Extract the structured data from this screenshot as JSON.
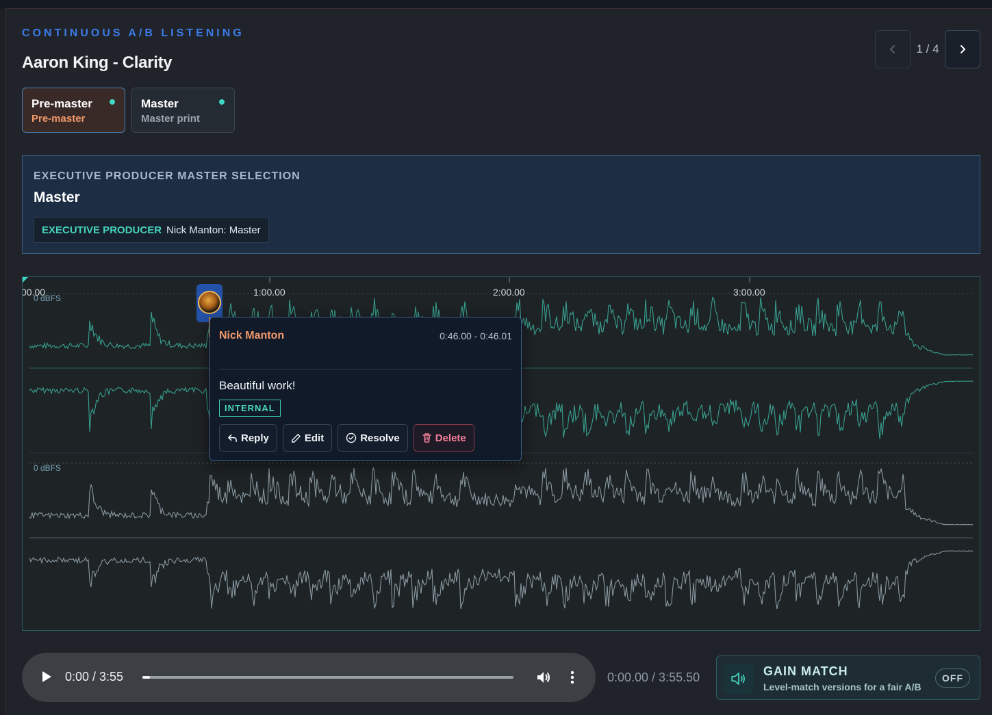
{
  "header": {
    "eyebrow": "CONTINUOUS A/B LISTENING",
    "track_title": "Aaron King - Clarity"
  },
  "pager": {
    "count": "1 / 4"
  },
  "versions": [
    {
      "name": "Pre-master",
      "sub": "Pre-master",
      "active": true
    },
    {
      "name": "Master",
      "sub": "Master print",
      "active": false
    }
  ],
  "exec_selection": {
    "label": "EXECUTIVE PRODUCER MASTER SELECTION",
    "value": "Master",
    "chip_role": "EXECUTIVE PRODUCER",
    "chip_text": "Nick Manton: Master"
  },
  "waveform": {
    "ticks": [
      "00.00",
      "1:00.00",
      "2:00.00",
      "3:00.00"
    ],
    "top_dbfs": "0 dBFS",
    "bottom_dbfs": "0 dBFS",
    "top_color": "#3aa896",
    "bottom_color": "#8fa0a8"
  },
  "comment": {
    "author": "Nick Manton",
    "range": "0:46.00 - 0:46.01",
    "body": "Beautiful work!",
    "badge": "INTERNAL",
    "actions": {
      "reply": "Reply",
      "edit": "Edit",
      "resolve": "Resolve",
      "delete": "Delete"
    }
  },
  "player": {
    "time": "0:00 / 3:55",
    "progress": 0.02
  },
  "clock": "0:00.00 / 3:55.50",
  "gain_match": {
    "title": "GAIN MATCH",
    "description": "Level-match versions for a fair A/B",
    "toggle": "OFF"
  },
  "colors": {
    "accent_blue": "#3d7be8",
    "teal": "#46d3bd",
    "orange": "#f2996c",
    "danger": "#f37f98"
  }
}
